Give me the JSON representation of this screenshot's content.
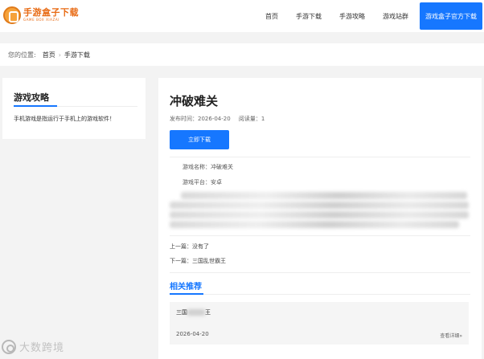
{
  "header": {
    "logo_title": "手游盒子下载",
    "logo_sub": "GAME BOX XIAZAI",
    "nav": [
      "首页",
      "手游下载",
      "手游攻略",
      "游戏站群"
    ],
    "cta": "游戏盒子官方下载"
  },
  "breadcrumb": {
    "prefix": "您的位置:",
    "home": "首页",
    "current": "手游下载"
  },
  "sidebar": {
    "title": "游戏攻略",
    "desc": "手机游戏是指运行于手机上的游戏软件！"
  },
  "article": {
    "title": "冲破难关",
    "publish_label": "发布时间：2026-04-20",
    "views_label": "阅读量：1",
    "download_label": "立即下载",
    "game_name": "游戏名称：冲破难关",
    "platform": "游戏平台：安卓",
    "prev": "上一篇：没有了",
    "next": "下一篇：三国乱世霸王"
  },
  "related": {
    "title": "相关推荐",
    "card": {
      "title_prefix": "三国",
      "title_suffix": "王",
      "date": "2026-04-20",
      "more": "查看详细»"
    }
  },
  "watermark": "大数跨境",
  "colors": {
    "accent": "#1677ff",
    "logo": "#e86a13"
  }
}
